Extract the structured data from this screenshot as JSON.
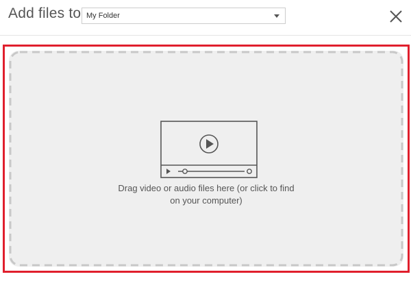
{
  "header": {
    "title": "Add files to",
    "folder_select": {
      "value": "My Folder"
    },
    "close_icon": "close-icon"
  },
  "dropzone": {
    "line1": "Drag video or audio files here (or click to find",
    "line2": "on your computer)",
    "icon": "video-player-icon",
    "highlight_color": "#e01f2d"
  }
}
